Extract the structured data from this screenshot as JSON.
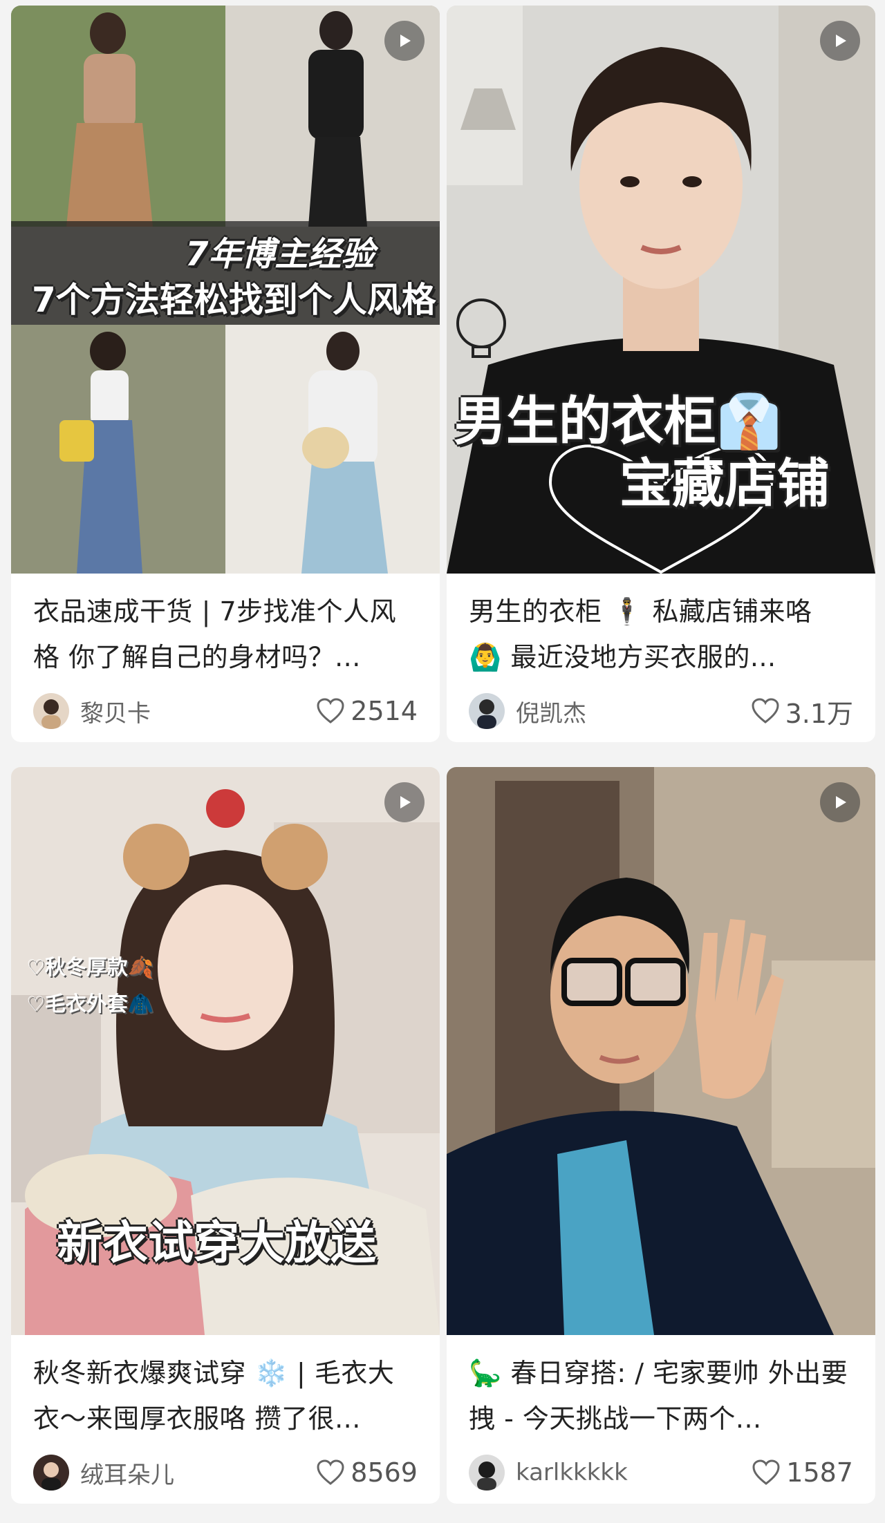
{
  "cards": [
    {
      "cover_text": [
        "7年博主经验",
        "7个方法轻松找到个人风格"
      ],
      "title": "衣品速成干货 | 7步找准个人风格 你了解自己的身材吗？...",
      "author": "黎贝卡",
      "likes": "2514",
      "is_video": true
    },
    {
      "cover_text": [
        "男生的衣柜👔",
        "宝藏店铺"
      ],
      "title": "男生的衣柜 🕴️ 私藏店铺来咯 🙆‍♂️ 最近没地方买衣服的...",
      "author": "倪凯杰",
      "likes": "3.1万",
      "is_video": true
    },
    {
      "cover_text": [
        "♡秋冬厚款🍂",
        "♡毛衣外套🧥",
        "新衣试穿大放送"
      ],
      "title": "秋冬新衣爆爽试穿 ❄️ | 毛衣大衣～来囤厚衣服咯 攒了很...",
      "author": "绒耳朵儿",
      "likes": "8569",
      "is_video": true
    },
    {
      "cover_text": [],
      "title": "🦕 春日穿搭: / 宅家要帅 外出要拽 - 今天挑战一下两个...",
      "author": "karlkkkkk",
      "likes": "1587",
      "is_video": true
    }
  ],
  "icons": {
    "play": "play-icon",
    "heart": "heart-outline-icon"
  },
  "colors": {
    "background": "#f3f3f3",
    "card": "#ffffff",
    "text": "#222222",
    "muted": "#666666"
  }
}
